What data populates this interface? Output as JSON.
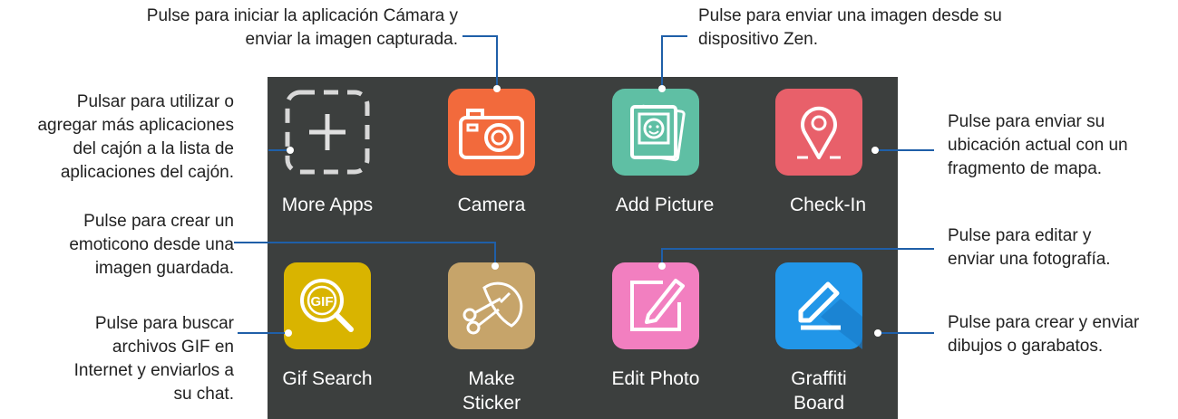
{
  "apps": [
    {
      "name": "More Apps",
      "color": "#3c3f3e"
    },
    {
      "name": "Camera",
      "color": "#f26a3c"
    },
    {
      "name": "Add Picture",
      "color": "#5fbfa4"
    },
    {
      "name": "Check-In",
      "color": "#e8606a"
    },
    {
      "name": "Gif Search",
      "color": "#d9b400"
    },
    {
      "name": "Make Sticker",
      "name_line1": "Make",
      "name_line2": "Sticker",
      "color": "#c6a46a"
    },
    {
      "name": "Edit Photo",
      "color": "#f27fc0"
    },
    {
      "name": "Graffiti Board",
      "name_line1": "Graffiti",
      "name_line2": "Board",
      "color": "#2196e8"
    }
  ],
  "callouts": {
    "camera_l1": "Pulse para iniciar la aplicación Cámara y",
    "camera_l2": "enviar la imagen capturada.",
    "addpic_l1": "Pulse para enviar una imagen desde su",
    "addpic_l2": "dispositivo Zen.",
    "more_l1": "Pulsar para utilizar o",
    "more_l2": "agregar más aplicaciones",
    "more_l3": "del cajón a la lista de",
    "more_l4": "aplicaciones del cajón.",
    "checkin_l1": "Pulse para enviar su",
    "checkin_l2": "ubicación actual con un",
    "checkin_l3": "fragmento de mapa.",
    "sticker_l1": "Pulse para crear un",
    "sticker_l2": "emoticono desde una",
    "sticker_l3": "imagen guardada.",
    "edit_l1": "Pulse para editar y",
    "edit_l2": "enviar una fotografía.",
    "gif_l1": "Pulse para buscar",
    "gif_l2": "archivos GIF en",
    "gif_l3": "Internet y enviarlos a",
    "gif_l4": "su chat.",
    "graffiti_l1": "Pulse para crear y enviar",
    "graffiti_l2": "dibujos o garabatos."
  },
  "colors": {
    "callout_line": "#1f5fa8",
    "panel": "#3c3f3e"
  },
  "icons": [
    "plus-icon",
    "camera-icon",
    "photo-stack-icon",
    "location-pin-icon",
    "gif-magnifier-icon",
    "scissors-icon",
    "pencil-edit-icon",
    "pen-draw-icon"
  ]
}
